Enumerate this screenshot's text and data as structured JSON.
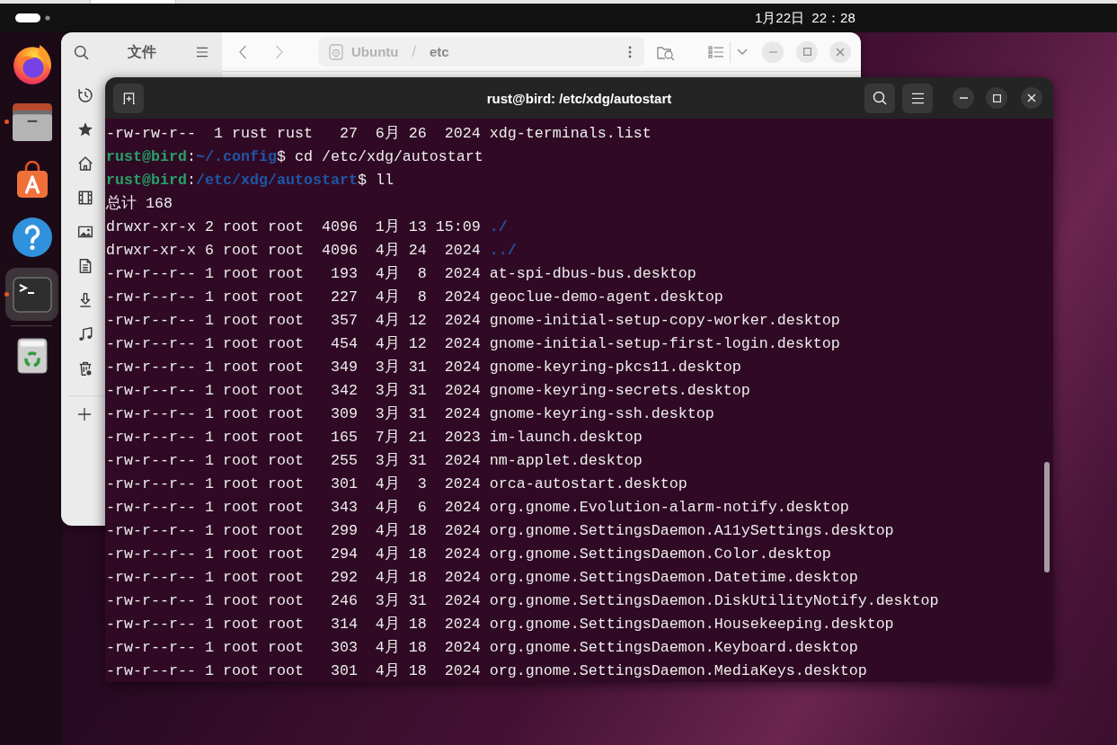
{
  "top_bar": {
    "clock": "1月22日  22：28"
  },
  "dock": {
    "apps": [
      {
        "kind": "browser",
        "running": false,
        "selected": false
      },
      {
        "kind": "files",
        "running": true,
        "selected": false
      },
      {
        "kind": "app-store",
        "running": false,
        "selected": false
      },
      {
        "kind": "help",
        "running": false,
        "selected": false
      },
      {
        "kind": "terminal",
        "running": true,
        "selected": true
      }
    ]
  },
  "files_window": {
    "title": "文件",
    "path_bar": {
      "separator": "/",
      "segments": [
        {
          "text": "Ubuntu",
          "current": false
        },
        {
          "text": "etc",
          "current": true
        }
      ]
    }
  },
  "terminal": {
    "title": "rust@bird: /etc/xdg/autostart",
    "lines": [
      {
        "kind": "listing",
        "meta": "-rw-rw-r--  1 rust rust   27  6月 26  2024",
        "name": "xdg-terminals.list",
        "dir": false
      },
      {
        "kind": "prompt",
        "user": "rust@bird",
        "sep": ":",
        "path": "~/.config",
        "symbol": "$",
        "command": "cd /etc/xdg/autostart"
      },
      {
        "kind": "prompt",
        "user": "rust@bird",
        "sep": ":",
        "path": "/etc/xdg/autostart",
        "symbol": "$",
        "command": "ll"
      },
      {
        "kind": "output",
        "text": "总计 168"
      },
      {
        "kind": "listing",
        "meta": "drwxr-xr-x 2 root root  4096  1月 13 15:09",
        "name": "./",
        "dir": true
      },
      {
        "kind": "listing",
        "meta": "drwxr-xr-x 6 root root  4096  4月 24  2024",
        "name": "../",
        "dir": true
      },
      {
        "kind": "listing",
        "meta": "-rw-r--r-- 1 root root   193  4月  8  2024",
        "name": "at-spi-dbus-bus.desktop",
        "dir": false
      },
      {
        "kind": "listing",
        "meta": "-rw-r--r-- 1 root root   227  4月  8  2024",
        "name": "geoclue-demo-agent.desktop",
        "dir": false
      },
      {
        "kind": "listing",
        "meta": "-rw-r--r-- 1 root root   357  4月 12  2024",
        "name": "gnome-initial-setup-copy-worker.desktop",
        "dir": false
      },
      {
        "kind": "listing",
        "meta": "-rw-r--r-- 1 root root   454  4月 12  2024",
        "name": "gnome-initial-setup-first-login.desktop",
        "dir": false
      },
      {
        "kind": "listing",
        "meta": "-rw-r--r-- 1 root root   349  3月 31  2024",
        "name": "gnome-keyring-pkcs11.desktop",
        "dir": false
      },
      {
        "kind": "listing",
        "meta": "-rw-r--r-- 1 root root   342  3月 31  2024",
        "name": "gnome-keyring-secrets.desktop",
        "dir": false
      },
      {
        "kind": "listing",
        "meta": "-rw-r--r-- 1 root root   309  3月 31  2024",
        "name": "gnome-keyring-ssh.desktop",
        "dir": false
      },
      {
        "kind": "listing",
        "meta": "-rw-r--r-- 1 root root   165  7月 21  2023",
        "name": "im-launch.desktop",
        "dir": false
      },
      {
        "kind": "listing",
        "meta": "-rw-r--r-- 1 root root   255  3月 31  2024",
        "name": "nm-applet.desktop",
        "dir": false
      },
      {
        "kind": "listing",
        "meta": "-rw-r--r-- 1 root root   301  4月  3  2024",
        "name": "orca-autostart.desktop",
        "dir": false
      },
      {
        "kind": "listing",
        "meta": "-rw-r--r-- 1 root root   343  4月  6  2024",
        "name": "org.gnome.Evolution-alarm-notify.desktop",
        "dir": false
      },
      {
        "kind": "listing",
        "meta": "-rw-r--r-- 1 root root   299  4月 18  2024",
        "name": "org.gnome.SettingsDaemon.A11ySettings.desktop",
        "dir": false
      },
      {
        "kind": "listing",
        "meta": "-rw-r--r-- 1 root root   294  4月 18  2024",
        "name": "org.gnome.SettingsDaemon.Color.desktop",
        "dir": false
      },
      {
        "kind": "listing",
        "meta": "-rw-r--r-- 1 root root   292  4月 18  2024",
        "name": "org.gnome.SettingsDaemon.Datetime.desktop",
        "dir": false
      },
      {
        "kind": "listing",
        "meta": "-rw-r--r-- 1 root root   246  3月 31  2024",
        "name": "org.gnome.SettingsDaemon.DiskUtilityNotify.desktop",
        "dir": false
      },
      {
        "kind": "listing",
        "meta": "-rw-r--r-- 1 root root   314  4月 18  2024",
        "name": "org.gnome.SettingsDaemon.Housekeeping.desktop",
        "dir": false
      },
      {
        "kind": "listing",
        "meta": "-rw-r--r-- 1 root root   303  4月 18  2024",
        "name": "org.gnome.SettingsDaemon.Keyboard.desktop",
        "dir": false
      },
      {
        "kind": "listing",
        "meta": "-rw-r--r-- 1 root root   301  4月 18  2024",
        "name": "org.gnome.SettingsDaemon.MediaKeys.desktop",
        "dir": false
      }
    ]
  }
}
